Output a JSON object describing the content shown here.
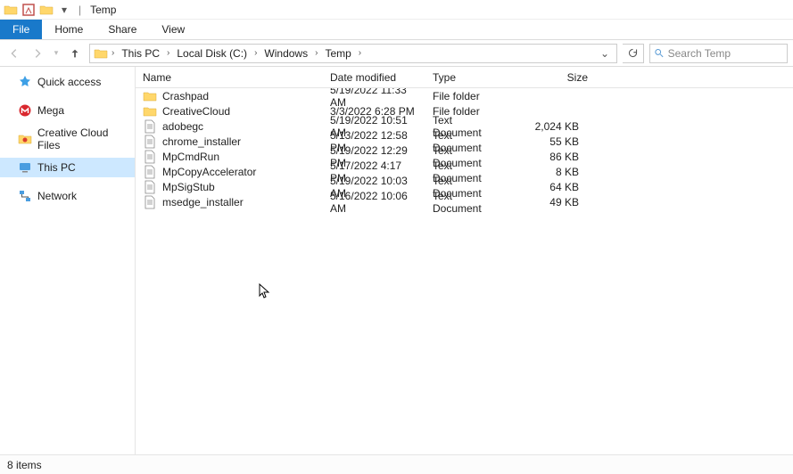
{
  "window": {
    "title": "Temp"
  },
  "ribbon": {
    "file": "File",
    "home": "Home",
    "share": "Share",
    "view": "View"
  },
  "breadcrumb": {
    "items": [
      "This PC",
      "Local Disk (C:)",
      "Windows",
      "Temp"
    ]
  },
  "search": {
    "placeholder": "Search Temp"
  },
  "nav": {
    "quick_access": "Quick access",
    "mega": "Mega",
    "creative_cloud": "Creative Cloud Files",
    "this_pc": "This PC",
    "network": "Network"
  },
  "columns": {
    "name": "Name",
    "date": "Date modified",
    "type": "Type",
    "size": "Size"
  },
  "items": [
    {
      "icon": "folder",
      "name": "Crashpad",
      "date": "5/19/2022 11:33 AM",
      "type": "File folder",
      "size": ""
    },
    {
      "icon": "folder",
      "name": "CreativeCloud",
      "date": "3/3/2022 6:28 PM",
      "type": "File folder",
      "size": ""
    },
    {
      "icon": "text",
      "name": "adobegc",
      "date": "5/19/2022 10:51 AM",
      "type": "Text Document",
      "size": "2,024 KB"
    },
    {
      "icon": "text",
      "name": "chrome_installer",
      "date": "5/13/2022 12:58 PM",
      "type": "Text Document",
      "size": "55 KB"
    },
    {
      "icon": "text",
      "name": "MpCmdRun",
      "date": "5/19/2022 12:29 PM",
      "type": "Text Document",
      "size": "86 KB"
    },
    {
      "icon": "text",
      "name": "MpCopyAccelerator",
      "date": "5/17/2022 4:17 PM",
      "type": "Text Document",
      "size": "8 KB"
    },
    {
      "icon": "text",
      "name": "MpSigStub",
      "date": "5/19/2022 10:03 AM",
      "type": "Text Document",
      "size": "64 KB"
    },
    {
      "icon": "text",
      "name": "msedge_installer",
      "date": "5/16/2022 10:06 AM",
      "type": "Text Document",
      "size": "49 KB"
    }
  ],
  "status": {
    "text": "8 items"
  }
}
